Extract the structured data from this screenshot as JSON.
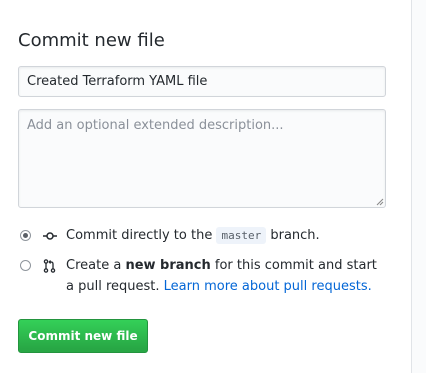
{
  "commit_form": {
    "title": "Commit new file",
    "summary_value": "Created Terraform YAML file",
    "description_placeholder": "Add an optional extended description...",
    "option_direct": {
      "prefix": "Commit directly to the",
      "branch": "master",
      "suffix": "branch.",
      "selected": true,
      "icon": "git-commit-icon"
    },
    "option_new_branch": {
      "prefix": "Create a",
      "bold": "new branch",
      "middle": "for this commit and start a pull request.",
      "link": "Learn more about pull requests.",
      "selected": false,
      "icon": "git-pull-request-icon"
    },
    "submit_label": "Commit new file"
  },
  "colors": {
    "button_green": "#28a745",
    "link_blue": "#0366d6",
    "text": "#24292e"
  }
}
